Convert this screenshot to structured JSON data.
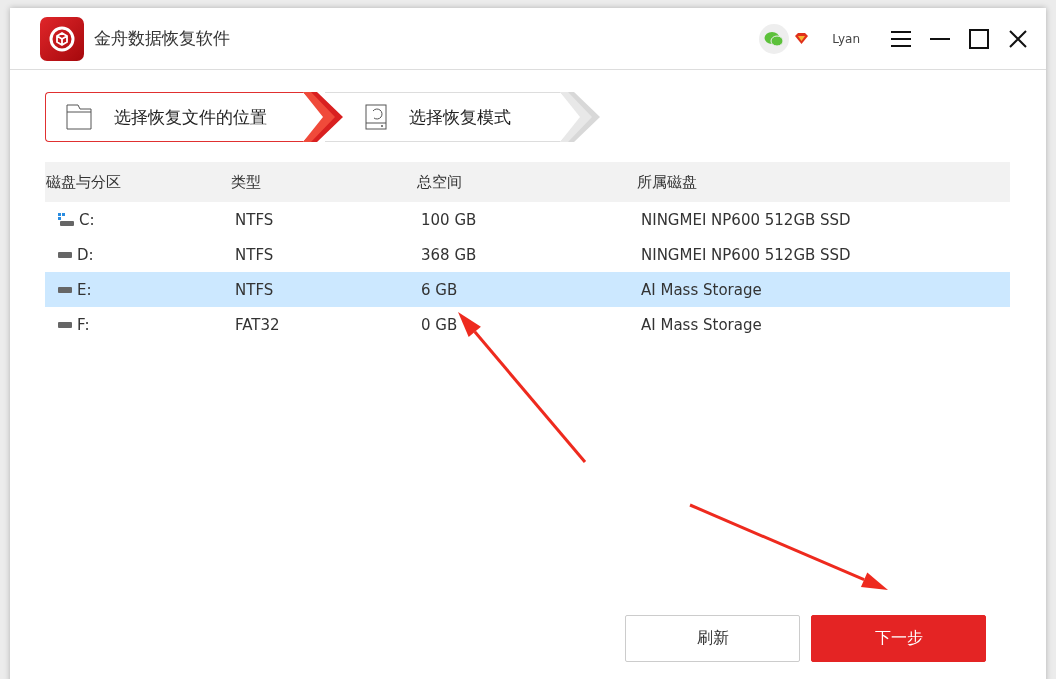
{
  "window": {
    "title": "金舟数据恢复软件",
    "user": "Lyan"
  },
  "steps": [
    {
      "label": "选择恢复文件的位置",
      "selected": true
    },
    {
      "label": "选择恢复模式",
      "selected": false
    }
  ],
  "table": {
    "columns": [
      "磁盘与分区",
      "类型",
      "总空间",
      "所属磁盘"
    ],
    "rows": [
      {
        "kind": "system",
        "drive": "C:",
        "type": "NTFS",
        "size": "100 GB",
        "disk": "NINGMEI NP600 512GB SSD",
        "selected": false
      },
      {
        "kind": "disk",
        "drive": "D:",
        "type": "NTFS",
        "size": "368 GB",
        "disk": "NINGMEI NP600 512GB SSD",
        "selected": false
      },
      {
        "kind": "disk",
        "drive": "E:",
        "type": "NTFS",
        "size": "6 GB",
        "disk": "AI Mass Storage",
        "selected": true
      },
      {
        "kind": "disk",
        "drive": "F:",
        "type": "FAT32",
        "size": "0 GB",
        "disk": "AI Mass Storage",
        "selected": false
      }
    ]
  },
  "buttons": {
    "refresh": "刷新",
    "next": "下一步"
  }
}
